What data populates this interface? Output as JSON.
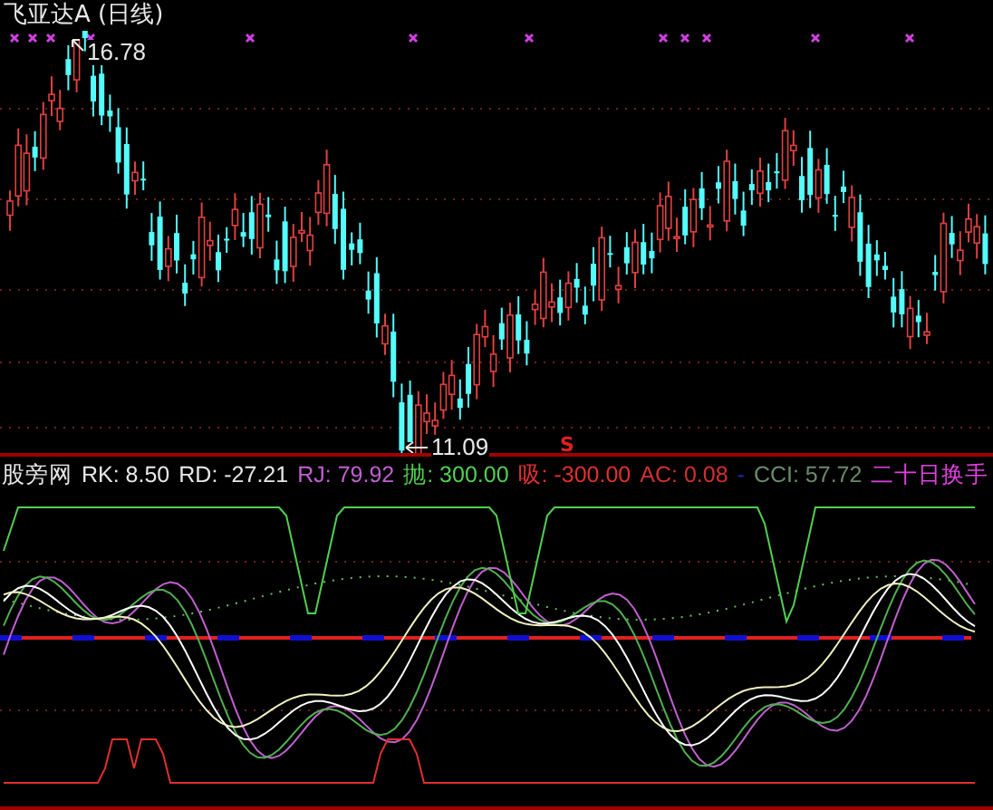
{
  "chart": {
    "title": "飞亚达A (日线)",
    "high_label": "16.78",
    "low_label": "11.09",
    "signal": "S"
  },
  "indicator": {
    "legend": [
      {
        "text": "股旁网",
        "color": "#e8e8e8"
      },
      {
        "text": "RK: 8.50",
        "color": "#e8e8e8"
      },
      {
        "text": "RD: -27.21",
        "color": "#e8e8e8"
      },
      {
        "text": "RJ: 79.92",
        "color": "#c060d0"
      },
      {
        "text": "抛: 300.00",
        "color": "#50d050"
      },
      {
        "text": "吸: -300.00",
        "color": "#e03030"
      },
      {
        "text": "AC: 0.08",
        "color": "#d03030"
      },
      {
        "text": "-",
        "color": "#2828a8"
      },
      {
        "text": "CCI: 57.72",
        "color": "#6a8a6a"
      },
      {
        "text": "二十日换手",
        "color": "#e040e0"
      }
    ]
  }
}
